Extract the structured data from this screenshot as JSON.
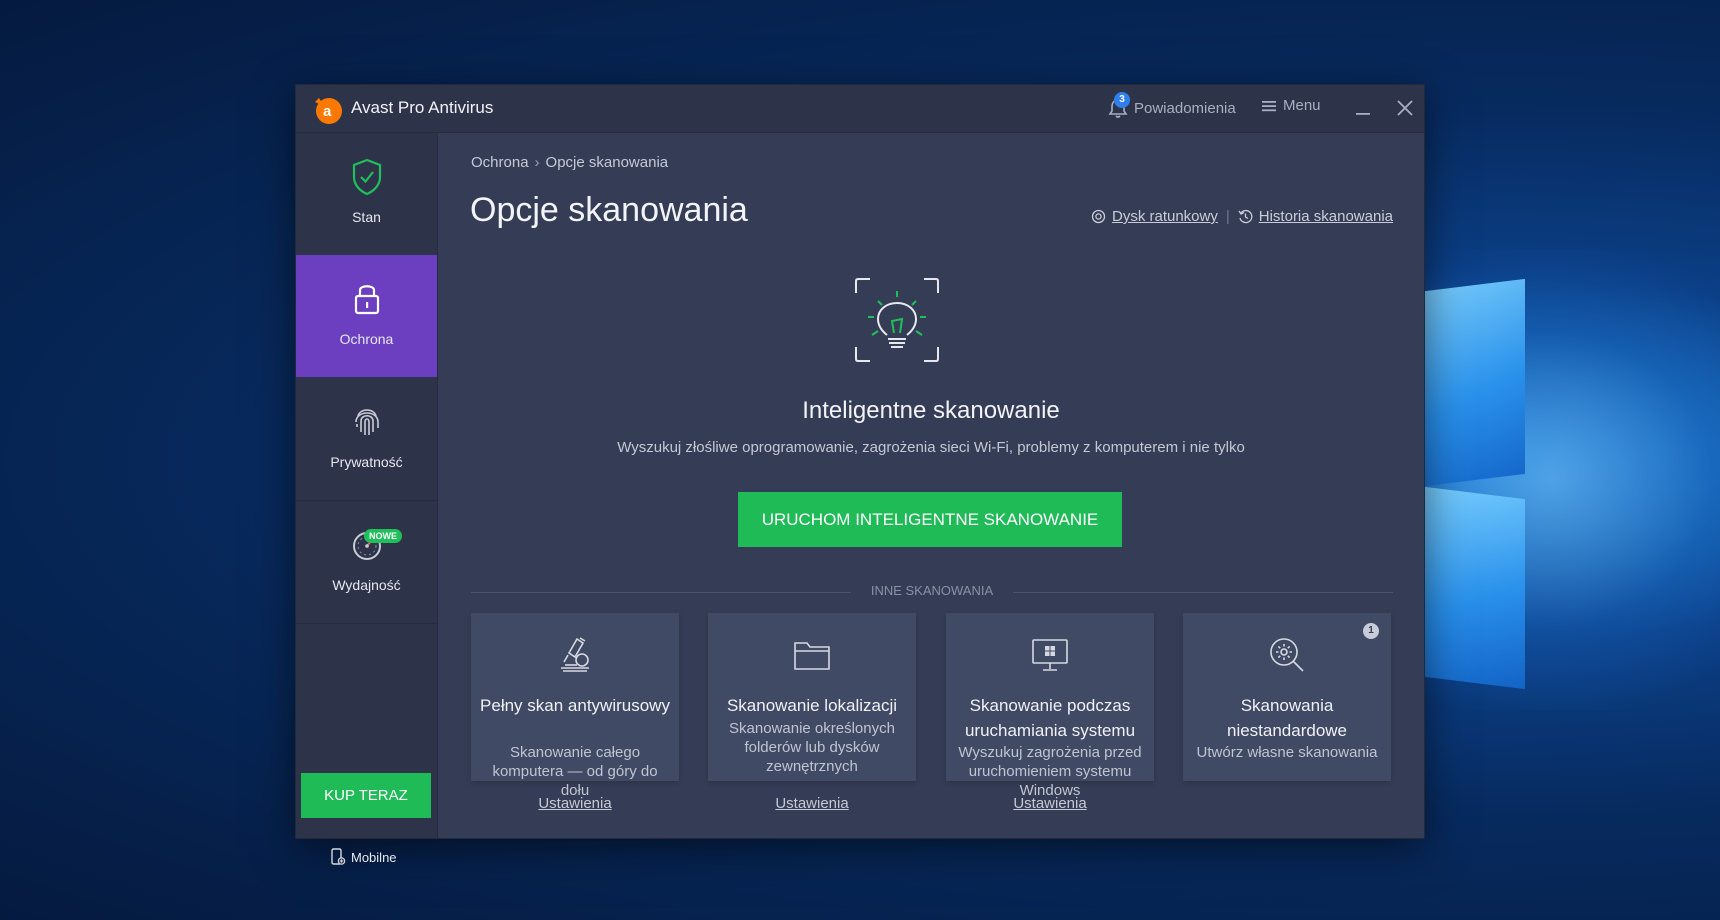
{
  "window": {
    "title": "Avast Pro Antivirus"
  },
  "titlebar": {
    "notifications_label": "Powiadomienia",
    "notifications_count": "3",
    "menu_label": "Menu"
  },
  "sidebar": {
    "items": [
      {
        "label": "Stan",
        "icon": "shield-check-icon"
      },
      {
        "label": "Ochrona",
        "icon": "lock-icon",
        "active": true
      },
      {
        "label": "Prywatność",
        "icon": "fingerprint-icon"
      },
      {
        "label": "Wydajność",
        "icon": "speedometer-icon",
        "badge": "NOWE"
      }
    ],
    "buy_label": "KUP TERAZ",
    "mobile_label": "Mobilne"
  },
  "main": {
    "breadcrumb": [
      "Ochrona",
      "Opcje skanowania"
    ],
    "page_title": "Opcje skanowania",
    "links": {
      "rescue_disk": "Dysk ratunkowy",
      "scan_history": "Historia skanowania"
    },
    "hero": {
      "title": "Inteligentne skanowanie",
      "subtitle": "Wyszukuj złośliwe oprogramowanie, zagrożenia sieci Wi-Fi, problemy z komputerem i nie tylko",
      "button": "URUCHOM INTELIGENTNE SKANOWANIE"
    },
    "other_scans_title": "INNE SKANOWANIA",
    "cards": [
      {
        "title": "Pełny skan antywirusowy",
        "desc": "Skanowanie całego komputera — od góry do dołu",
        "settings": "Ustawienia",
        "icon": "microscope-icon"
      },
      {
        "title": "Skanowanie lokalizacji",
        "desc": "Skanowanie określonych folderów lub dysków zewnętrznych",
        "settings": "Ustawienia",
        "icon": "folder-icon"
      },
      {
        "title": "Skanowanie podczas uruchamiania systemu",
        "desc": "Wyszukuj zagrożenia przed uruchomieniem systemu Windows",
        "settings": "Ustawienia",
        "icon": "monitor-windows-icon"
      },
      {
        "title": "Skanowania niestandardowe",
        "desc": "Utwórz własne skanowania",
        "badge": "1",
        "icon": "search-gear-icon"
      }
    ]
  },
  "colors": {
    "accent_purple": "#6c3fc1",
    "accent_green": "#1fbb57",
    "brand_orange": "#ff7800"
  }
}
